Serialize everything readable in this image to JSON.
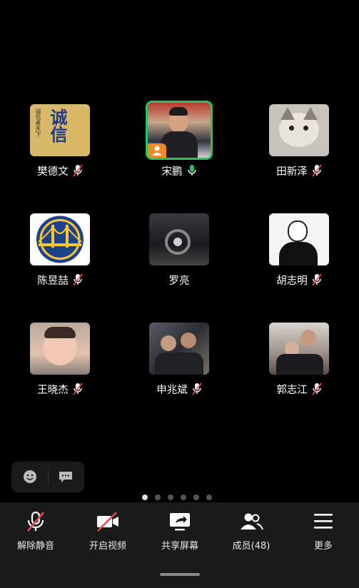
{
  "participants": [
    {
      "name": "樊德文",
      "mic": "muted",
      "avatar": "calligraphy-avatar"
    },
    {
      "name": "宋鹏",
      "mic": "speaking",
      "avatar": "man-photo-avatar"
    },
    {
      "name": "田新泽",
      "mic": "muted",
      "avatar": "cat-avatar"
    },
    {
      "name": "陈昱喆",
      "mic": "muted",
      "avatar": "warriors-logo-avatar"
    },
    {
      "name": "罗亮",
      "mic": "none",
      "avatar": "car-interior-avatar"
    },
    {
      "name": "胡志明",
      "mic": "muted",
      "avatar": "cartoon-boy-avatar"
    },
    {
      "name": "王晓杰",
      "mic": "muted",
      "avatar": "baby-avatar"
    },
    {
      "name": "申兆斌",
      "mic": "muted",
      "avatar": "group-photo-avatar"
    },
    {
      "name": "郭志江",
      "mic": "muted",
      "avatar": "family-photo-avatar"
    }
  ],
  "calligraphy": {
    "big": "诚信",
    "small": "诚信者天下"
  },
  "pagination": {
    "pages": 6,
    "current": 1
  },
  "toolbar": {
    "unmute": "解除静音",
    "start_video": "开启视频",
    "share_screen": "共享屏幕",
    "members": "成员(48)",
    "more": "更多"
  },
  "colors": {
    "speaking_border": "#22c55e",
    "host_badge": "#f08a24",
    "mic_muted": "#e5484d",
    "mic_active": "#22c55e"
  }
}
